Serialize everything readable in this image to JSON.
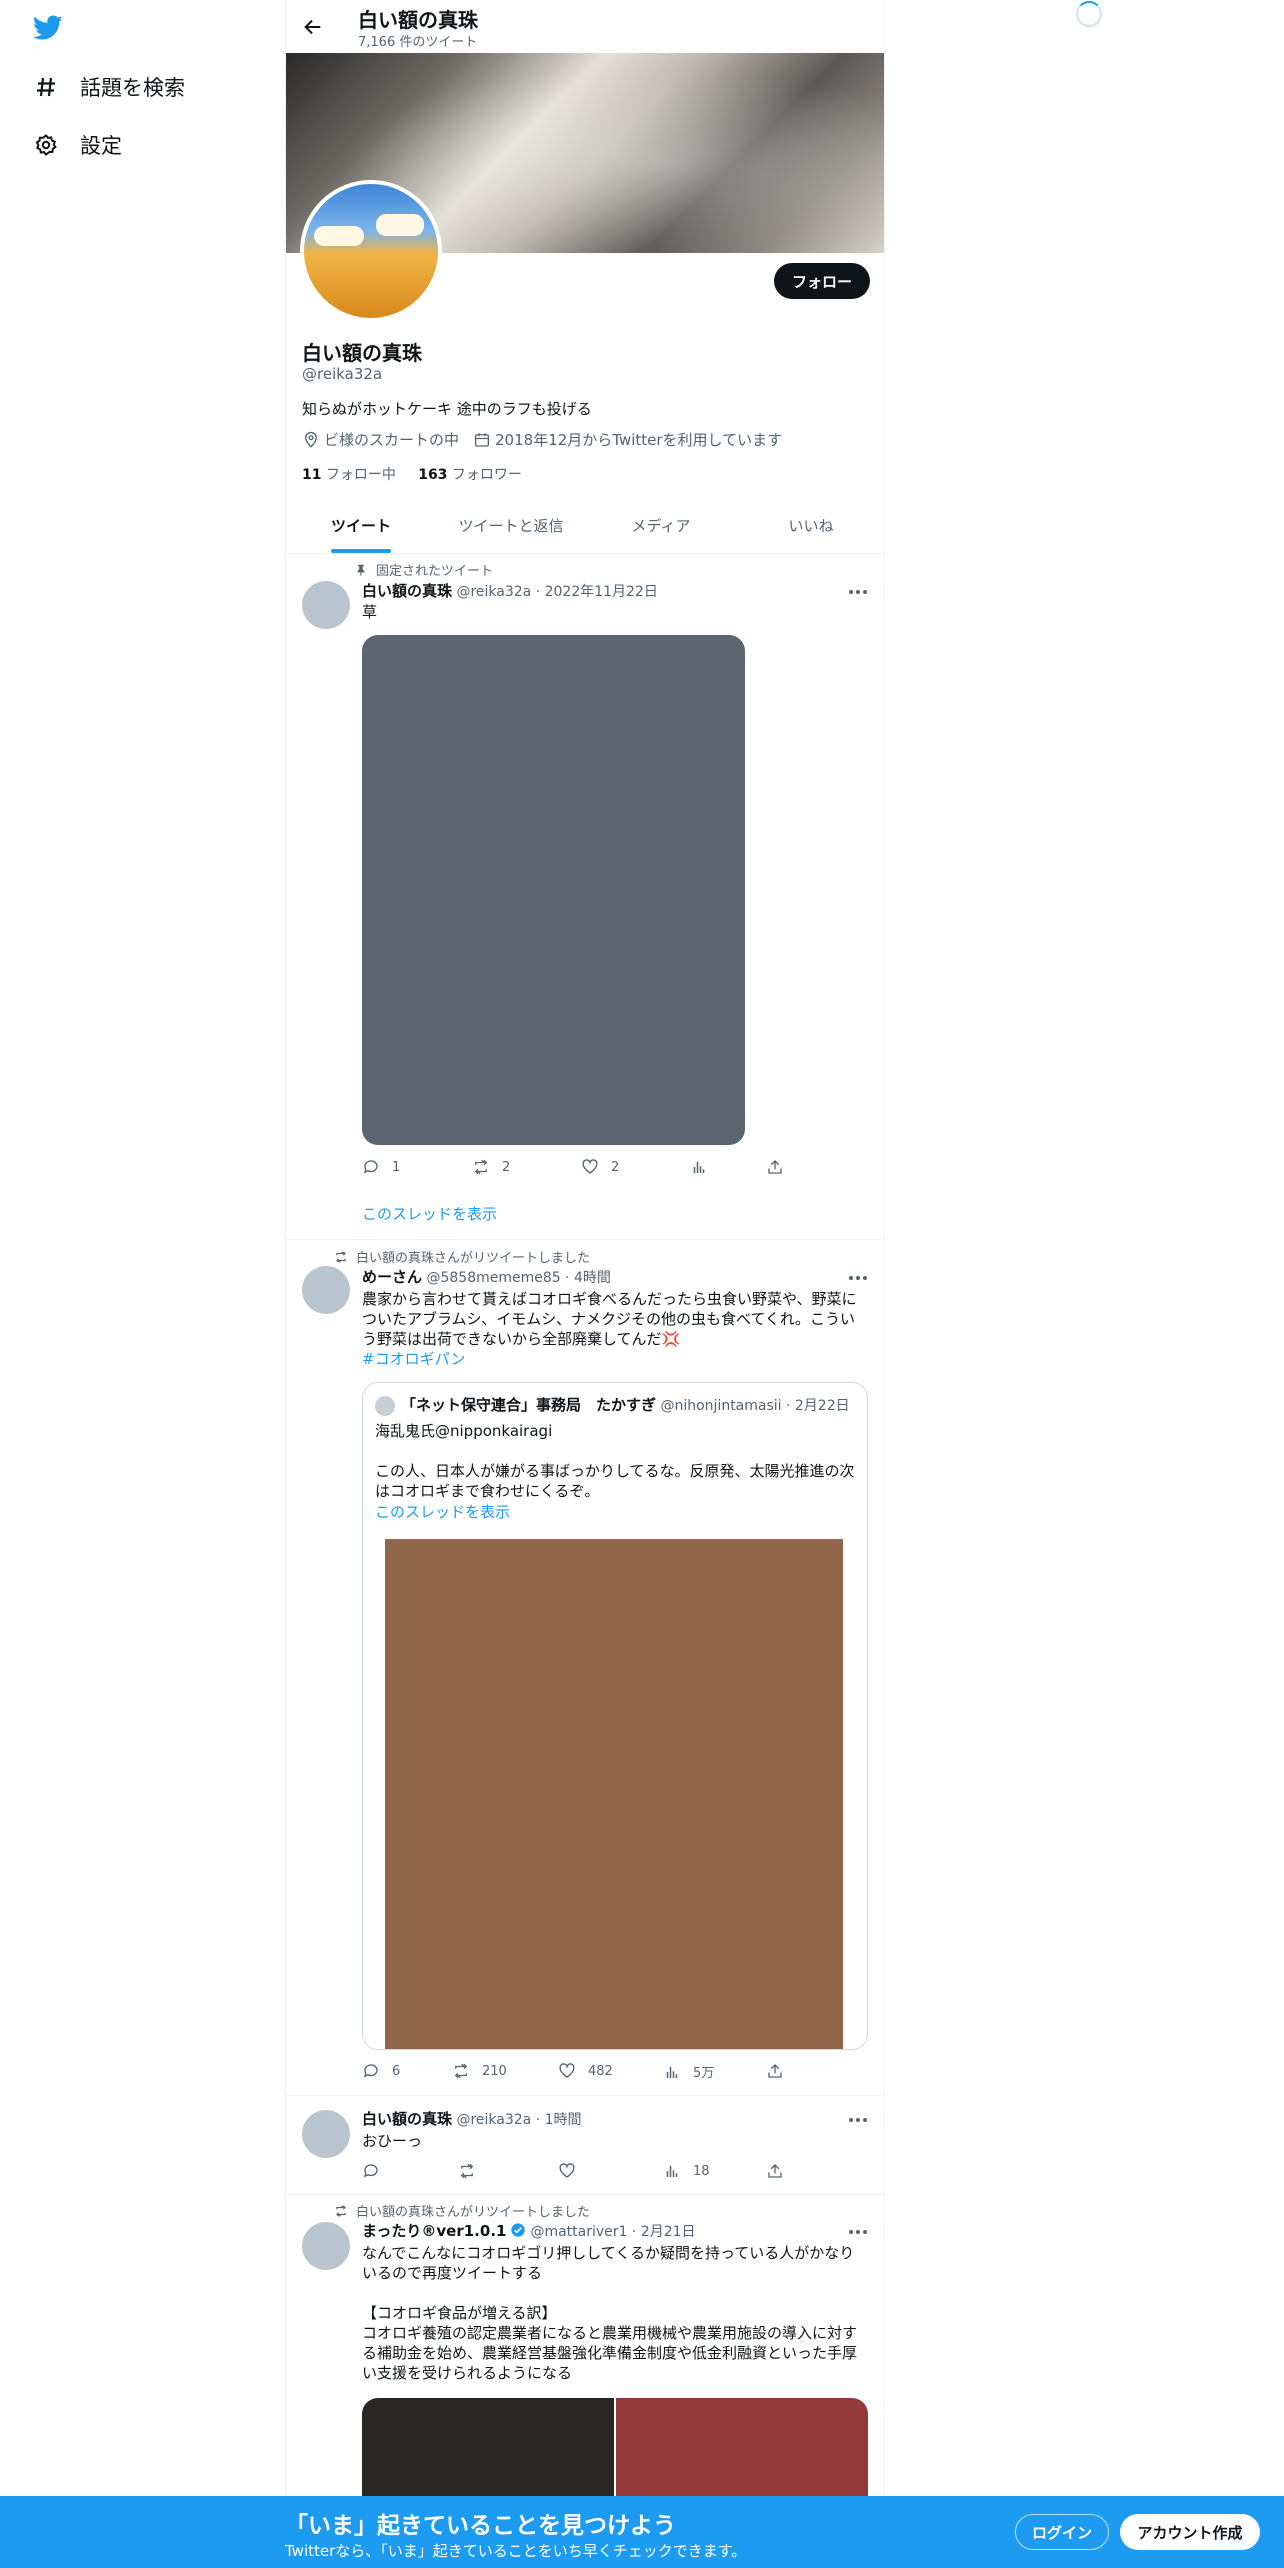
{
  "nav": {
    "items": [
      {
        "label": "話題を検索",
        "icon": "hashtag-icon"
      },
      {
        "label": "設定",
        "icon": "gear-icon"
      }
    ]
  },
  "header": {
    "title": "白い額の真珠",
    "subtitle": "7,166 件のツイート"
  },
  "profile": {
    "follow_label": "フォロー",
    "name": "白い額の真珠",
    "handle": "@reika32a",
    "bio": "知らぬがホットケーキ 途中のラフも投げる",
    "location": "ビ様のスカートの中",
    "joined": "2018年12月からTwitterを利用しています",
    "following_count": "11",
    "following_label": "フォロー中",
    "followers_count": "163",
    "followers_label": "フォロワー"
  },
  "tabs": [
    "ツイート",
    "ツイートと返信",
    "メディア",
    "いいね"
  ],
  "tweets": [
    {
      "context": "固定されたツイート",
      "name": "白い額の真珠",
      "meta": "@reika32a · 2022年11月22日",
      "text": "草",
      "replies": "1",
      "retweets": "2",
      "likes": "2",
      "thread_link": "このスレッドを表示"
    },
    {
      "context": "白い額の真珠さんがリツイートしました",
      "name": "めーさん",
      "meta": "@5858mememe85 · 4時間",
      "text": "農家から言わせて貰えばコオロギ食べるんだったら虫食い野菜や、野菜についたアブラムシ、イモムシ、ナメクジその他の虫も食べてくれ。こういう野菜は出荷できないから全部廃棄してんだ💢",
      "hashtag": "#コオロギパン",
      "quote": {
        "name": "「ネット保守連合」事務局　たかすぎ",
        "meta": "@nihonjintamasii · 2月22日",
        "text": "海乱鬼氏@nipponkairagi\n\nこの人、日本人が嫌がる事ばっかりしてるな。反原発、太陽光推進の次はコオロギまで食わせにくるぞ。",
        "thread_link": "このスレッドを表示"
      },
      "replies": "6",
      "retweets": "210",
      "likes": "482",
      "views": "5万"
    },
    {
      "name": "白い額の真珠",
      "meta": "@reika32a · 1時間",
      "text": "おひーっ",
      "views": "18"
    },
    {
      "context": "白い額の真珠さんがリツイートしました",
      "name": "まったり®ver1.0.1",
      "meta": "@mattariver1 · 2月21日",
      "text": "なんでこんなにコオロギゴリ押ししてくるか疑問を持っている人がかなりいるので再度ツイートする\n\n【コオロギ食品が増える訳】\nコオロギ養殖の認定農業者になると農業用機械や農業用施設の導入に対する補助金を始め、農業経営基盤強化準備金制度や低金利融資といった手厚い支援を受けられるようになる"
    }
  ],
  "bottom_bar": {
    "title": "「いま」起きていることを見つけよう",
    "subtitle": "Twitterなら、「いま」起きていることをいち早くチェックできます。",
    "login_label": "ログイン",
    "signup_label": "アカウント作成"
  },
  "colors": {
    "accent": "#1d9bf0",
    "text": "#0f1419",
    "muted": "#536471"
  }
}
